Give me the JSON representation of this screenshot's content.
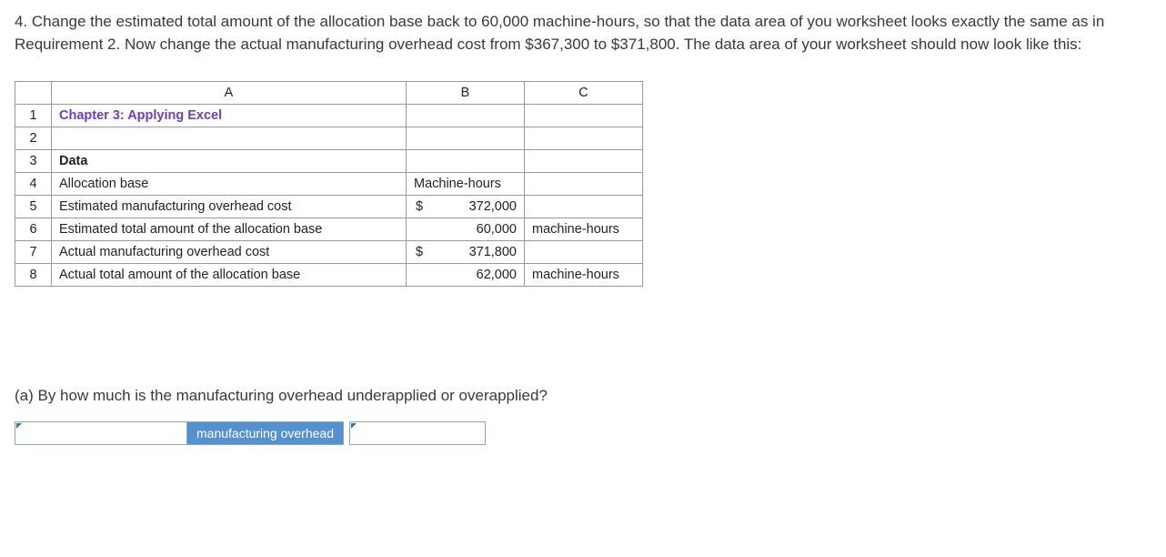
{
  "instruction": "4. Change the estimated total amount of the allocation base back to 60,000 machine-hours, so that the data area of you worksheet looks exactly the same as in Requirement 2. Now change the actual manufacturing overhead cost from $367,300 to $371,800. The data area of your worksheet should now look like this:",
  "spreadsheet": {
    "columns": {
      "a": "A",
      "b": "B",
      "c": "C"
    },
    "rows": {
      "r1": {
        "num": "1",
        "a": "Chapter 3: Applying Excel",
        "b": "",
        "c": ""
      },
      "r2": {
        "num": "2",
        "a": "",
        "b": "",
        "c": ""
      },
      "r3": {
        "num": "3",
        "a": "Data",
        "b": "",
        "c": ""
      },
      "r4": {
        "num": "4",
        "a": "Allocation base",
        "b": "Machine-hours",
        "c": ""
      },
      "r5": {
        "num": "5",
        "a": "Estimated manufacturing overhead cost",
        "b_dollar": "$",
        "b_val": "372,000",
        "c": ""
      },
      "r6": {
        "num": "6",
        "a": "Estimated total amount of the allocation base",
        "b_val": "60,000",
        "c": "machine-hours"
      },
      "r7": {
        "num": "7",
        "a": "Actual manufacturing overhead cost",
        "b_dollar": "$",
        "b_val": "371,800",
        "c": ""
      },
      "r8": {
        "num": "8",
        "a": "Actual total amount of the allocation base",
        "b_val": "62,000",
        "c": "machine-hours"
      }
    }
  },
  "question": "(a) By how much is the manufacturing overhead underapplied or overapplied?",
  "answer_label": "manufacturing overhead"
}
